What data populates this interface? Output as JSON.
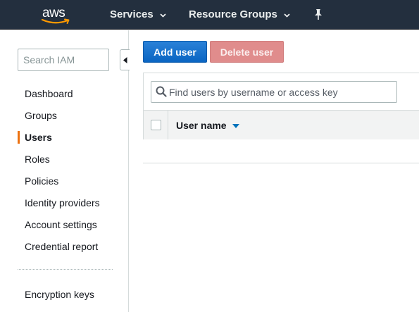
{
  "header": {
    "logo_text": "aws",
    "nav": [
      {
        "label": "Services"
      },
      {
        "label": "Resource Groups"
      }
    ]
  },
  "sidebar": {
    "search_placeholder": "Search IAM",
    "items": [
      {
        "label": "Dashboard"
      },
      {
        "label": "Groups"
      },
      {
        "label": "Users",
        "active": true
      },
      {
        "label": "Roles"
      },
      {
        "label": "Policies"
      },
      {
        "label": "Identity providers"
      },
      {
        "label": "Account settings"
      },
      {
        "label": "Credential report"
      }
    ],
    "secondary_items": [
      {
        "label": "Encryption keys"
      }
    ]
  },
  "toolbar": {
    "add_label": "Add user",
    "delete_label": "Delete user"
  },
  "table": {
    "filter_placeholder": "Find users by username or access key",
    "columns": [
      {
        "label": "User name"
      }
    ]
  },
  "colors": {
    "topbar": "#232f3e",
    "primary_button": "#0d6ed1",
    "disabled_delete": "#e08c8c",
    "active_indicator": "#ec7211",
    "sort_arrow": "#0073bb"
  }
}
